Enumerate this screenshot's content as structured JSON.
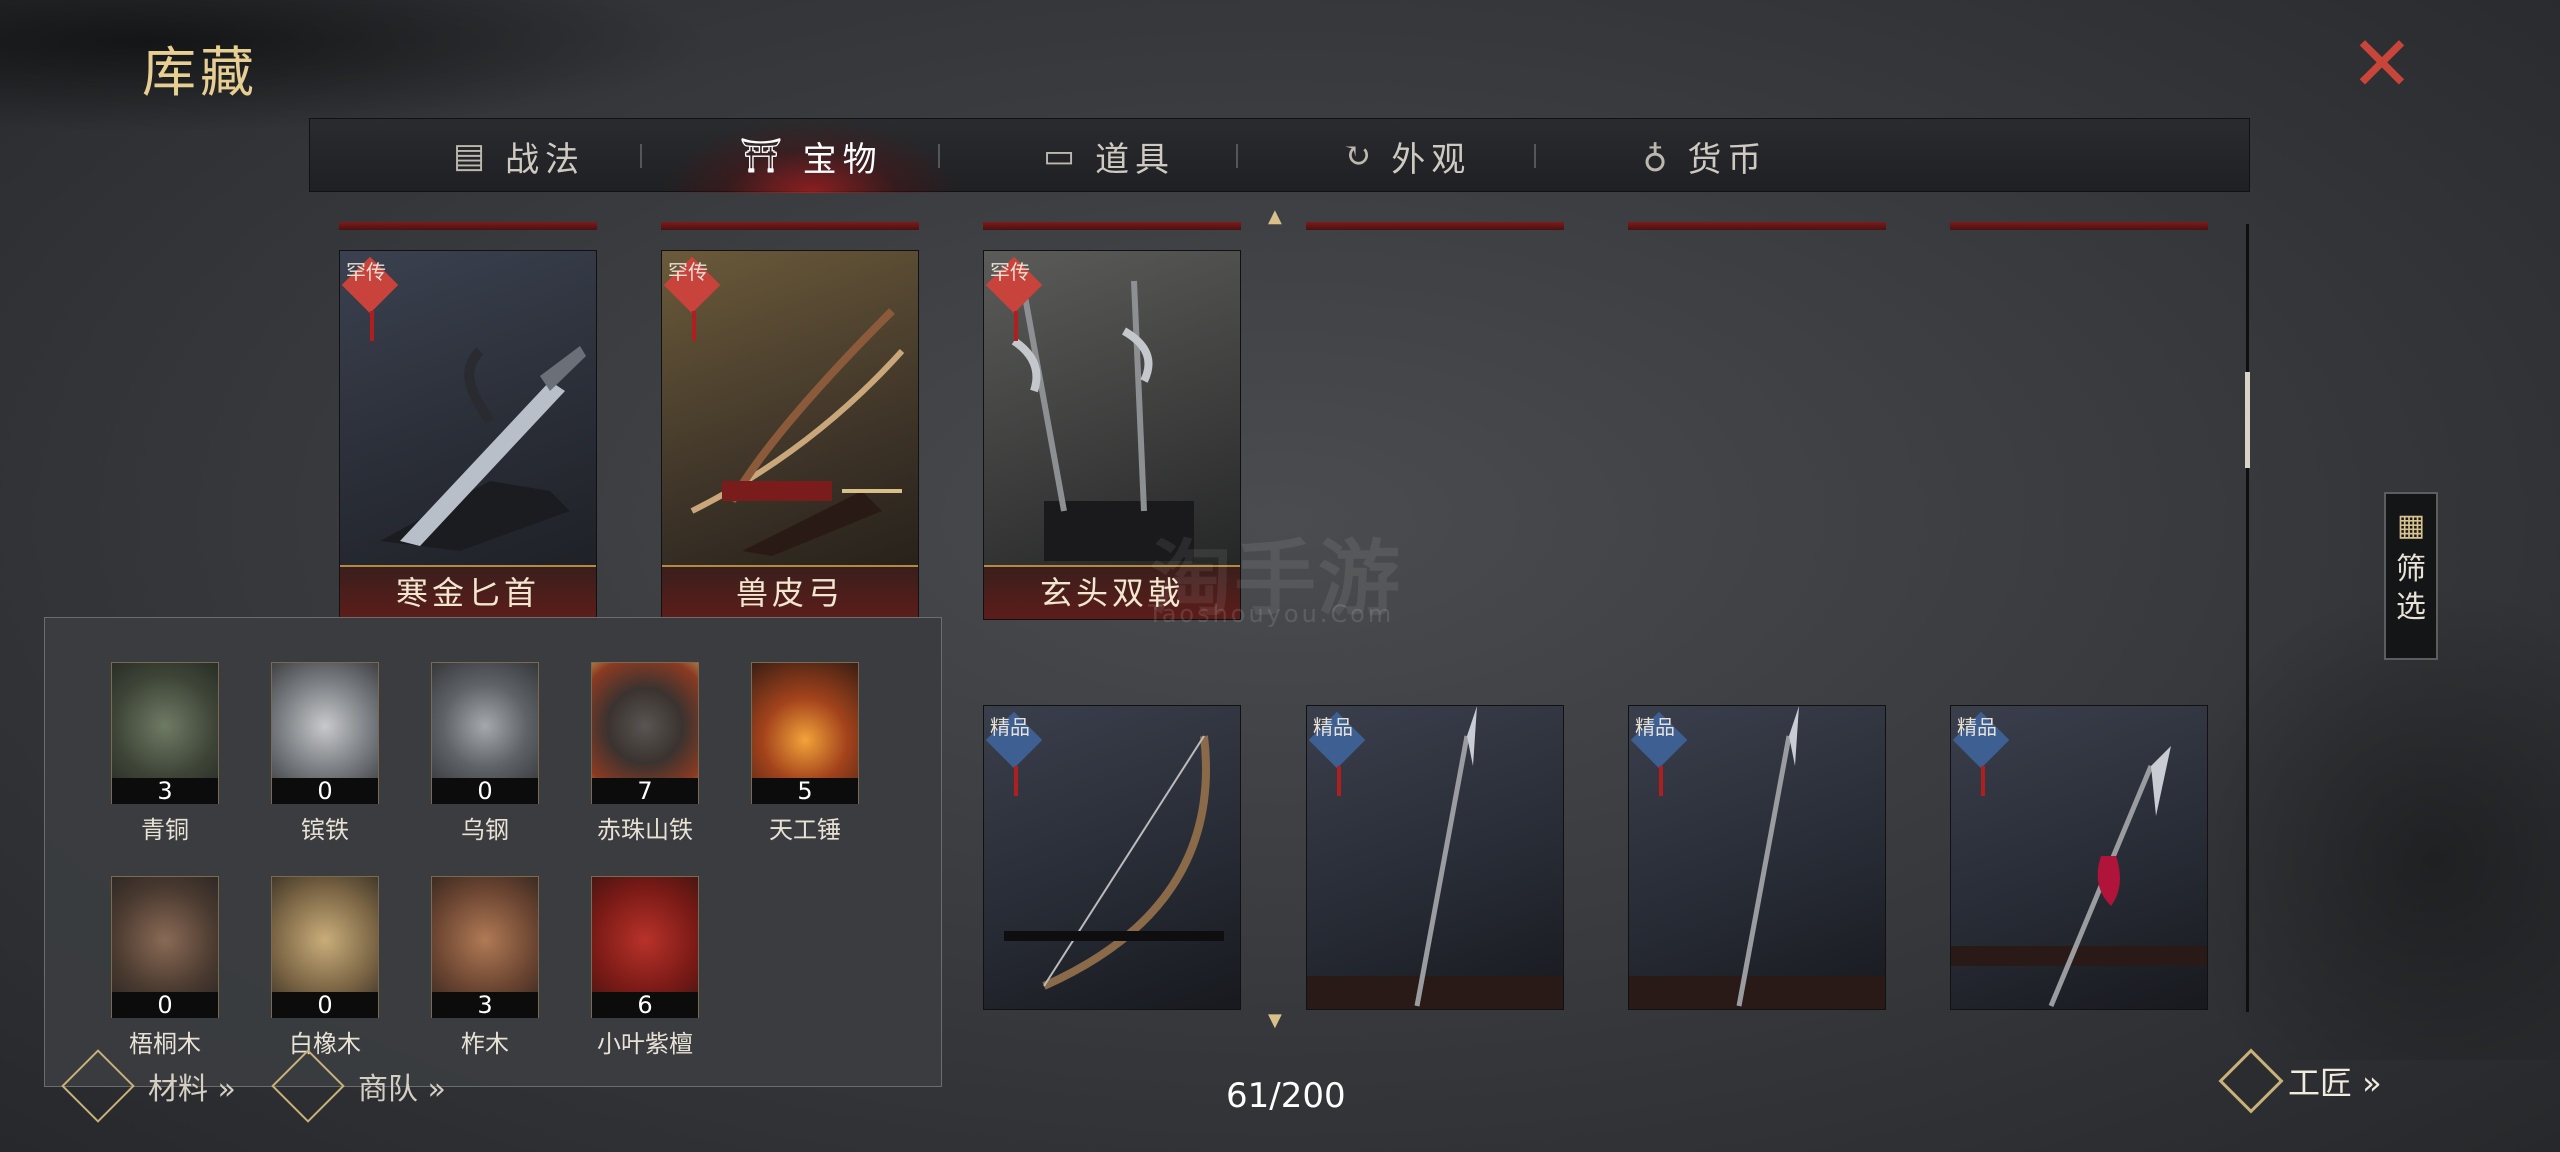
{
  "title": "库藏",
  "tabs": [
    {
      "label": "战法",
      "icon": "scroll-icon",
      "active": false
    },
    {
      "label": "宝物",
      "icon": "treasure-icon",
      "active": true
    },
    {
      "label": "道具",
      "icon": "box-icon",
      "active": false
    },
    {
      "label": "外观",
      "icon": "appearance-icon",
      "active": false
    },
    {
      "label": "货币",
      "icon": "coin-bag-icon",
      "active": false
    }
  ],
  "treasures": [
    {
      "name": "寒金匕首",
      "grade": "罕传",
      "grade_color": "#c8433b"
    },
    {
      "name": "兽皮弓",
      "grade": "罕传",
      "grade_color": "#c8433b"
    },
    {
      "name": "玄头双戟",
      "grade": "罕传",
      "grade_color": "#c8433b"
    },
    {
      "name": "",
      "grade": "精品",
      "grade_color": "#3e5f92"
    },
    {
      "name": "",
      "grade": "精品",
      "grade_color": "#3e5f92"
    },
    {
      "name": "",
      "grade": "精品",
      "grade_color": "#3e5f92"
    },
    {
      "name": "",
      "grade": "精品",
      "grade_color": "#3e5f92"
    }
  ],
  "materials": [
    {
      "name": "青铜",
      "count": "3",
      "icon": "bronze-ore-icon"
    },
    {
      "name": "镔铁",
      "count": "0",
      "icon": "iron-ingot-icon"
    },
    {
      "name": "乌钢",
      "count": "0",
      "icon": "steel-ingot-icon"
    },
    {
      "name": "赤珠山铁",
      "count": "7",
      "icon": "red-iron-ore-icon"
    },
    {
      "name": "天工锤",
      "count": "5",
      "icon": "hammer-icon"
    },
    {
      "name": "梧桐木",
      "count": "0",
      "icon": "wutong-log-icon"
    },
    {
      "name": "白橡木",
      "count": "0",
      "icon": "oak-log-icon"
    },
    {
      "name": "柞木",
      "count": "3",
      "icon": "zuo-log-icon"
    },
    {
      "name": "小叶紫檀",
      "count": "6",
      "icon": "rosewood-log-icon"
    }
  ],
  "footer": {
    "materials_link": "材料 »",
    "caravan_link": "商队 »",
    "capacity": "61/200",
    "craftsman_link": "工匠 »"
  },
  "filter": {
    "label": "筛选"
  },
  "watermark": {
    "main": "淘手游",
    "sub": "Taoshouyou.Com"
  },
  "colors": {
    "accent_gold": "#e7cf93",
    "close_red": "#c8453a",
    "active_tab_glow": "#b01f1f"
  }
}
